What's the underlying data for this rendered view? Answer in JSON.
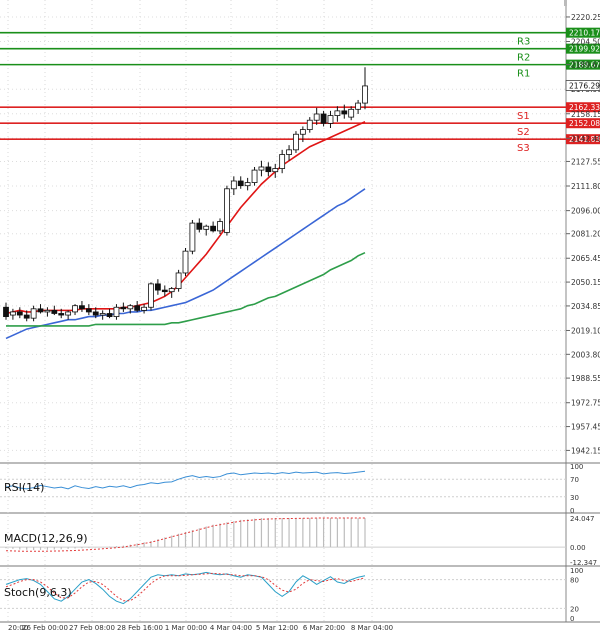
{
  "chart_data": {
    "type": "candlestick",
    "instrument_hint": "",
    "price_axis": {
      "ticks": [
        "2220.25",
        "2204.50",
        "2189.67",
        "2173.90",
        "2158.15",
        "2142.40",
        "2127.55",
        "2111.80",
        "2096.00",
        "2081.20",
        "2065.45",
        "2050.15",
        "2034.85",
        "2019.10",
        "2003.80",
        "1988.55",
        "1972.75",
        "1957.45",
        "1942.15"
      ],
      "range": [
        1942.15,
        2220.25
      ]
    },
    "levels": [
      {
        "label": "R3",
        "value": "2210.17",
        "color": "#1a8f1a"
      },
      {
        "label": "R2",
        "value": "2199.92",
        "color": "#1a8f1a"
      },
      {
        "label": "R1",
        "value": "2189.67",
        "color": "#1a8f1a"
      },
      {
        "label": "S1",
        "value": "2162.33",
        "color": "#dd2222"
      },
      {
        "label": "S2",
        "value": "2152.08",
        "color": "#dd2222"
      },
      {
        "label": "S3",
        "value": "2141.83",
        "color": "#dd2222"
      }
    ],
    "current_price": "2176.29",
    "x_axis_labels": [
      "20:00",
      "26 Feb 00:00",
      "27 Feb 08:00",
      "28 Feb 16:00",
      "1 Mar 00:00",
      "4 Mar 04:00",
      "5 Mar 12:00",
      "6 Mar 20:00",
      "8 Mar 04:00"
    ],
    "candles": [
      [
        2034,
        2037,
        2026,
        2028
      ],
      [
        2029,
        2033,
        2026,
        2031
      ],
      [
        2031,
        2034,
        2027,
        2029
      ],
      [
        2029,
        2032,
        2025,
        2027
      ],
      [
        2027,
        2035,
        2025,
        2033
      ],
      [
        2033,
        2036,
        2030,
        2031
      ],
      [
        2031,
        2034,
        2028,
        2032
      ],
      [
        2032,
        2035,
        2029,
        2030
      ],
      [
        2030,
        2033,
        2027,
        2029
      ],
      [
        2029,
        2032,
        2026,
        2031
      ],
      [
        2031,
        2036,
        2029,
        2035
      ],
      [
        2035,
        2038,
        2031,
        2033
      ],
      [
        2033,
        2036,
        2029,
        2031
      ],
      [
        2031,
        2034,
        2027,
        2029
      ],
      [
        2029,
        2032,
        2026,
        2030
      ],
      [
        2030,
        2033,
        2027,
        2028
      ],
      [
        2028,
        2036,
        2026,
        2034
      ],
      [
        2034,
        2037,
        2031,
        2033
      ],
      [
        2033,
        2036,
        2030,
        2035
      ],
      [
        2035,
        2038,
        2031,
        2032
      ],
      [
        2032,
        2036,
        2030,
        2034
      ],
      [
        2034,
        2050,
        2032,
        2049
      ],
      [
        2049,
        2052,
        2042,
        2045
      ],
      [
        2045,
        2048,
        2041,
        2044
      ],
      [
        2044,
        2047,
        2040,
        2046
      ],
      [
        2046,
        2058,
        2044,
        2056
      ],
      [
        2056,
        2072,
        2054,
        2070
      ],
      [
        2070,
        2090,
        2068,
        2088
      ],
      [
        2088,
        2091,
        2082,
        2084
      ],
      [
        2084,
        2087,
        2080,
        2086
      ],
      [
        2086,
        2089,
        2082,
        2083
      ],
      [
        2083,
        2091,
        2081,
        2089
      ],
      [
        2082,
        2112,
        2080,
        2110
      ],
      [
        2110,
        2118,
        2106,
        2115
      ],
      [
        2115,
        2118,
        2110,
        2112
      ],
      [
        2112,
        2117,
        2109,
        2114
      ],
      [
        2114,
        2124,
        2112,
        2122
      ],
      [
        2122,
        2128,
        2118,
        2124
      ],
      [
        2124,
        2127,
        2118,
        2121
      ],
      [
        2121,
        2126,
        2117,
        2123
      ],
      [
        2123,
        2135,
        2120,
        2132
      ],
      [
        2132,
        2138,
        2128,
        2135
      ],
      [
        2135,
        2147,
        2133,
        2145
      ],
      [
        2145,
        2150,
        2140,
        2148
      ],
      [
        2148,
        2156,
        2146,
        2154
      ],
      [
        2154,
        2162,
        2151,
        2158
      ],
      [
        2158,
        2160,
        2150,
        2152
      ],
      [
        2152,
        2160,
        2149,
        2157
      ],
      [
        2157,
        2163,
        2153,
        2160
      ],
      [
        2160,
        2164,
        2155,
        2158
      ],
      [
        2156,
        2163,
        2154,
        2161
      ],
      [
        2161,
        2167,
        2158,
        2165
      ],
      [
        2165,
        2188,
        2161,
        2176
      ]
    ],
    "moving_averages": [
      {
        "color": "#e01515",
        "values": [
          2030,
          2031,
          2032,
          2031,
          2031,
          2032,
          2032,
          2032,
          2032,
          2032,
          2032,
          2033,
          2033,
          2033,
          2033,
          2033,
          2033,
          2034,
          2034,
          2035,
          2036,
          2037,
          2039,
          2041,
          2044,
          2048,
          2053,
          2058,
          2063,
          2068,
          2074,
          2080,
          2086,
          2092,
          2098,
          2103,
          2108,
          2113,
          2117,
          2121,
          2125,
          2128,
          2131,
          2134,
          2137,
          2139,
          2141,
          2143,
          2145,
          2147,
          2149,
          2151,
          2153
        ]
      },
      {
        "color": "#3a66d6",
        "values": [
          2014,
          2016,
          2018,
          2020,
          2021,
          2022,
          2023,
          2024,
          2025,
          2026,
          2026,
          2027,
          2028,
          2028,
          2029,
          2029,
          2030,
          2030,
          2031,
          2031,
          2032,
          2032,
          2033,
          2034,
          2035,
          2036,
          2037,
          2039,
          2041,
          2043,
          2045,
          2048,
          2051,
          2054,
          2057,
          2060,
          2063,
          2066,
          2069,
          2072,
          2075,
          2078,
          2081,
          2084,
          2087,
          2090,
          2093,
          2096,
          2099,
          2101,
          2104,
          2107,
          2110
        ]
      },
      {
        "color": "#2e9e4a",
        "values": [
          2022,
          2022,
          2022,
          2022,
          2022,
          2022,
          2022,
          2022,
          2022,
          2022,
          2022,
          2022,
          2022,
          2023,
          2023,
          2023,
          2023,
          2023,
          2023,
          2023,
          2023,
          2023,
          2023,
          2023,
          2024,
          2024,
          2025,
          2026,
          2027,
          2028,
          2029,
          2030,
          2031,
          2032,
          2033,
          2035,
          2036,
          2038,
          2040,
          2041,
          2043,
          2045,
          2047,
          2049,
          2051,
          2053,
          2055,
          2058,
          2060,
          2062,
          2064,
          2067,
          2069
        ]
      }
    ],
    "indicators": [
      {
        "name": "RSI(14)",
        "ticks": [
          "100",
          "70",
          "30",
          "0"
        ]
      },
      {
        "name": "MACD(12,26,9)",
        "ticks": [
          "24.047",
          "0.00",
          "-12.347"
        ]
      },
      {
        "name": "Stoch(9,6,3)",
        "ticks": [
          "100",
          "80",
          "20",
          "0"
        ]
      }
    ],
    "rsi": [
      52,
      55,
      50,
      48,
      51,
      56,
      53,
      50,
      52,
      48,
      55,
      51,
      49,
      53,
      50,
      54,
      52,
      55,
      51,
      56,
      58,
      62,
      60,
      63,
      64,
      70,
      75,
      78,
      74,
      76,
      74,
      76,
      82,
      84,
      80,
      82,
      84,
      83,
      84,
      82,
      85,
      83,
      86,
      84,
      85,
      86,
      82,
      84,
      85,
      83,
      84,
      86,
      88
    ],
    "macd_hist": [
      -1,
      -1.5,
      -2,
      -2.2,
      -2.4,
      -2.4,
      -2.2,
      -2,
      -1.8,
      -1.5,
      -1.2,
      -1,
      -0.6,
      -0.3,
      0,
      0.4,
      0.8,
      1.2,
      2,
      3,
      4,
      5,
      6.5,
      8,
      9.5,
      11,
      12.5,
      14,
      15.5,
      17,
      18.5,
      19.5,
      20.5,
      21.5,
      22.5,
      23,
      23.5,
      24,
      24,
      24,
      24,
      24,
      24,
      24,
      24,
      24,
      24,
      24,
      24,
      24,
      24,
      24,
      24
    ],
    "macd_signal": [
      -3,
      -3.2,
      -3.4,
      -3.5,
      -3.5,
      -3.5,
      -3.4,
      -3.3,
      -3.2,
      -3,
      -2.8,
      -2.5,
      -2.2,
      -1.8,
      -1.4,
      -1,
      -0.5,
      0,
      1,
      2,
      3,
      4,
      5.5,
      7,
      8.5,
      10,
      11.5,
      13,
      14.5,
      16,
      17.5,
      18.5,
      19.5,
      20.5,
      21.5,
      22,
      22.5,
      23,
      23.2,
      23.4,
      23.5,
      23.6,
      23.7,
      23.8,
      23.9,
      24,
      24,
      24,
      24,
      24,
      24,
      24,
      24
    ],
    "stoch_k": [
      70,
      75,
      80,
      82,
      78,
      70,
      55,
      40,
      35,
      45,
      60,
      75,
      80,
      72,
      60,
      45,
      35,
      30,
      40,
      55,
      70,
      85,
      90,
      88,
      90,
      88,
      92,
      90,
      92,
      95,
      92,
      90,
      92,
      88,
      85,
      90,
      88,
      85,
      70,
      55,
      45,
      55,
      75,
      88,
      80,
      70,
      78,
      86,
      75,
      72,
      80,
      85,
      88
    ],
    "stoch_d": [
      65,
      70,
      76,
      80,
      80,
      75,
      65,
      52,
      42,
      42,
      52,
      65,
      75,
      76,
      70,
      58,
      45,
      36,
      36,
      45,
      58,
      72,
      82,
      88,
      88,
      88,
      89,
      90,
      91,
      92,
      93,
      92,
      91,
      90,
      88,
      88,
      88,
      86,
      80,
      68,
      58,
      54,
      60,
      72,
      80,
      78,
      76,
      80,
      82,
      78,
      76,
      80,
      84
    ]
  }
}
